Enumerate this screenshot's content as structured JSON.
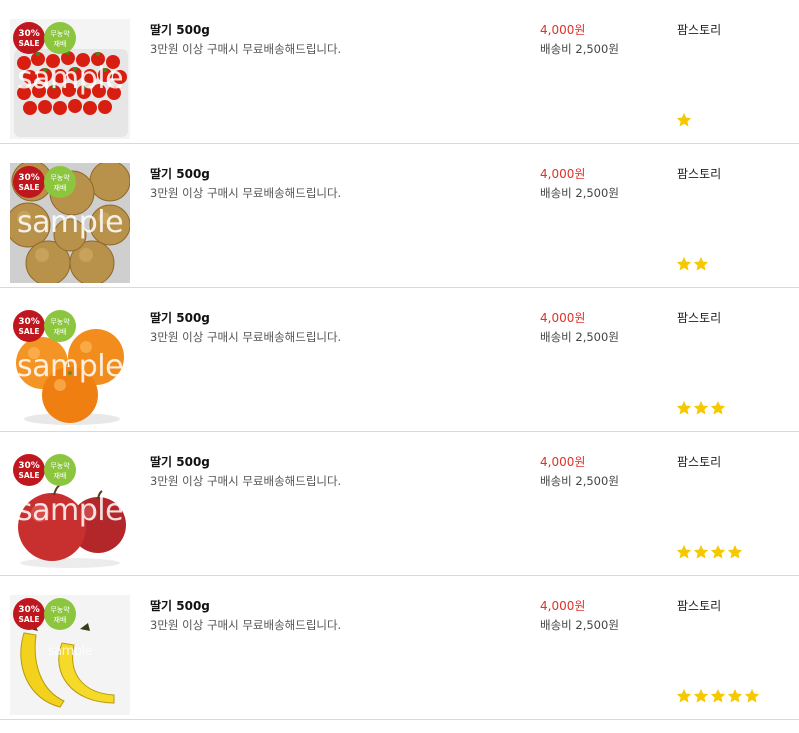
{
  "colors": {
    "price": "#d9342b",
    "star": "#f5c800",
    "sale_badge": "#c0161d",
    "eco_badge": "#8cc63f",
    "divider": "#d9d9d9"
  },
  "badges": {
    "sale_top": "30%",
    "sale_bottom": "SALE",
    "eco_top": "무농약",
    "eco_bottom": "재배"
  },
  "products": [
    {
      "name": "딸기 500g",
      "desc": "3만원 이상 구매시 무료배송해드립니다.",
      "price": "4,000원",
      "shipping": "배송비 2,500원",
      "seller": "팜스토리",
      "rating": 1,
      "image": "cherry-tomatoes",
      "watermark": "sample"
    },
    {
      "name": "딸기 500g",
      "desc": "3만원 이상 구매시 무료배송해드립니다.",
      "price": "4,000원",
      "shipping": "배송비 2,500원",
      "seller": "팜스토리",
      "rating": 2,
      "image": "pears",
      "watermark": "sample"
    },
    {
      "name": "딸기 500g",
      "desc": "3만원 이상 구매시 무료배송해드립니다.",
      "price": "4,000원",
      "shipping": "배송비 2,500원",
      "seller": "팜스토리",
      "rating": 3,
      "image": "oranges",
      "watermark": "sample"
    },
    {
      "name": "딸기 500g",
      "desc": "3만원 이상 구매시 무료배송해드립니다.",
      "price": "4,000원",
      "shipping": "배송비 2,500원",
      "seller": "팜스토리",
      "rating": 4,
      "image": "apples",
      "watermark": "sample"
    },
    {
      "name": "딸기 500g",
      "desc": "3만원 이상 구매시 무료배송해드립니다.",
      "price": "4,000원",
      "shipping": "배송비 2,500원",
      "seller": "팜스토리",
      "rating": 5,
      "image": "bananas",
      "watermark": "sample"
    }
  ]
}
